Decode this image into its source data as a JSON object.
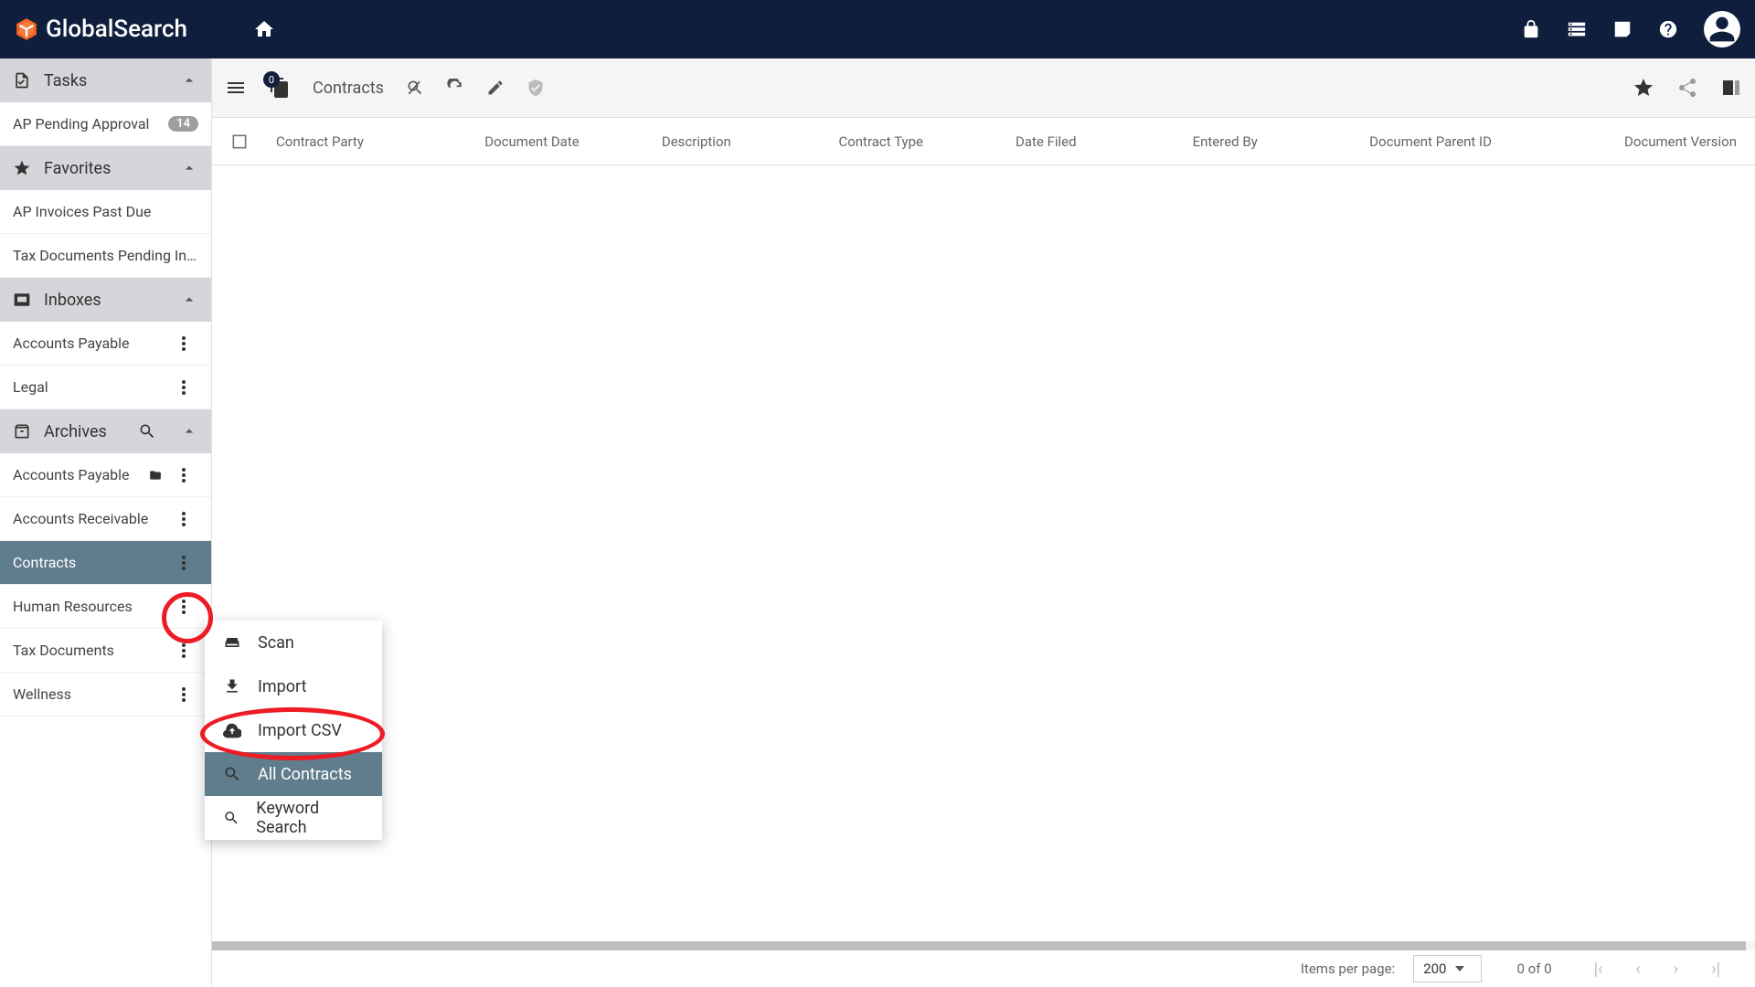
{
  "brand": "GlobalSearch",
  "header": {
    "icons": [
      "lock-icon",
      "storage-icon",
      "edit-note-icon",
      "help-icon",
      "account-icon"
    ]
  },
  "sidebar": {
    "tasks": {
      "label": "Tasks",
      "items": [
        {
          "label": "AP Pending Approval",
          "badge": "14"
        }
      ]
    },
    "favorites": {
      "label": "Favorites",
      "items": [
        {
          "label": "AP Invoices Past Due"
        },
        {
          "label": "Tax Documents Pending Inde…"
        }
      ]
    },
    "inboxes": {
      "label": "Inboxes",
      "items": [
        {
          "label": "Accounts Payable"
        },
        {
          "label": "Legal"
        }
      ]
    },
    "archives": {
      "label": "Archives",
      "items": [
        {
          "label": "Accounts Payable",
          "has_folder": true
        },
        {
          "label": "Accounts Receivable"
        },
        {
          "label": "Contracts",
          "active": true
        },
        {
          "label": "Human Resources"
        },
        {
          "label": "Tax Documents"
        },
        {
          "label": "Wellness"
        }
      ]
    }
  },
  "toolbar": {
    "doc_count": "0",
    "title": "Contracts"
  },
  "table": {
    "columns": [
      "Contract Party",
      "Document Date",
      "Description",
      "Contract Type",
      "Date Filed",
      "Entered By",
      "Document Parent ID",
      "Document Version"
    ]
  },
  "paginator": {
    "label": "Items per page:",
    "page_size": "200",
    "range": "0 of 0"
  },
  "context_menu": {
    "items": [
      {
        "label": "Scan",
        "icon": "scanner-icon"
      },
      {
        "label": "Import",
        "icon": "import-icon"
      },
      {
        "label": "Import CSV",
        "icon": "cloud-upload-icon"
      },
      {
        "label": "All Contracts",
        "icon": "search-icon",
        "highlight": true
      },
      {
        "label": "Keyword Search",
        "icon": "search-icon"
      }
    ]
  }
}
